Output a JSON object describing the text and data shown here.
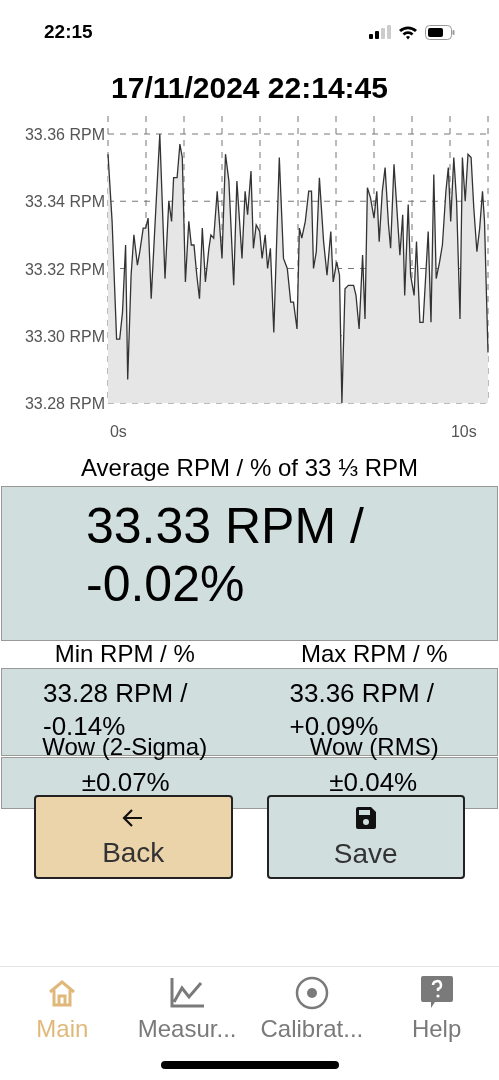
{
  "status_bar": {
    "time": "22:15"
  },
  "title": "17/11/2024 22:14:45",
  "chart": {
    "chart_data": {
      "type": "area",
      "grid": true,
      "xlim": [
        -0.3,
        10.7
      ],
      "ylim": [
        33.28,
        33.36
      ],
      "xticks": [
        {
          "value": 0,
          "label": "0s"
        },
        {
          "value": 10,
          "label": "10s"
        }
      ],
      "yticks": [
        {
          "value": 33.28,
          "label": "33.28 RPM"
        },
        {
          "value": 33.3,
          "label": "33.30 RPM"
        },
        {
          "value": 33.32,
          "label": "33.32 RPM"
        },
        {
          "value": 33.34,
          "label": "33.34 RPM"
        },
        {
          "value": 33.36,
          "label": "33.36 RPM"
        }
      ],
      "x": [
        -0.3,
        -0.18,
        -0.05,
        0.04,
        0.12,
        0.21,
        0.27,
        0.37,
        0.45,
        0.55,
        0.62,
        0.72,
        0.79,
        0.86,
        0.95,
        1.08,
        1.2,
        1.35,
        1.46,
        1.54,
        1.6,
        1.7,
        1.78,
        1.85,
        1.94,
        2.04,
        2.11,
        2.19,
        2.27,
        2.35,
        2.43,
        2.52,
        2.62,
        2.68,
        2.76,
        2.86,
        3,
        3.1,
        3.2,
        3.34,
        3.43,
        3.58,
        3.67,
        3.74,
        3.84,
        3.91,
        3.99,
        4.09,
        4.16,
        4.25,
        4.32,
        4.4,
        4.5,
        4.66,
        4.78,
        4.89,
        4.99,
        5.07,
        5.17,
        5.24,
        5.31,
        5.41,
        5.51,
        5.59,
        5.65,
        5.73,
        5.82,
        5.94,
        6.04,
        6.15,
        6.22,
        6.32,
        6.4,
        6.47,
        6.56,
        6.66,
        6.81,
        6.88,
        6.97,
        7.07,
        7.14,
        7.21,
        7.3,
        7.4,
        7.48,
        7.55,
        7.64,
        7.72,
        7.82,
        7.88,
        7.98,
        8.15,
        8.23,
        8.29,
        8.39,
        8.46,
        8.56,
        8.63,
        8.73,
        8.82,
        8.97,
        9.05,
        9.13,
        9.2,
        9.3,
        9.38,
        9.48,
        9.55,
        9.62,
        9.71,
        9.79,
        9.89,
        9.96,
        10.04,
        10.12,
        10.21,
        10.29,
        10.38,
        10.46,
        10.54,
        10.6,
        10.7
      ],
      "series": [
        {
          "color": "#e6e6e6",
          "values": [
            33.354,
            33.334,
            33.299,
            33.299,
            33.307,
            33.327,
            33.287,
            33.318,
            33.33,
            33.321,
            33.325,
            33.332,
            33.332,
            33.335,
            33.311,
            33.337,
            33.36,
            33.317,
            33.34,
            33.334,
            33.347,
            33.347,
            33.357,
            33.353,
            33.316,
            33.334,
            33.327,
            33.327,
            33.318,
            33.311,
            33.332,
            33.316,
            33.326,
            33.33,
            33.329,
            33.343,
            33.323,
            33.354,
            33.346,
            33.315,
            33.346,
            33.323,
            33.343,
            33.336,
            33.349,
            33.326,
            33.333,
            33.331,
            33.323,
            33.33,
            33.32,
            33.326,
            33.301,
            33.353,
            33.323,
            33.32,
            33.31,
            33.31,
            33.302,
            33.332,
            33.329,
            33.334,
            33.343,
            33.343,
            33.32,
            33.325,
            33.347,
            33.328,
            33.318,
            33.331,
            33.316,
            33.322,
            33.318,
            33.28,
            33.314,
            33.315,
            33.315,
            33.312,
            33.302,
            33.324,
            33.305,
            33.344,
            33.341,
            33.335,
            33.343,
            33.328,
            33.343,
            33.35,
            33.333,
            33.326,
            33.351,
            33.324,
            33.336,
            33.312,
            33.339,
            33.318,
            33.312,
            33.328,
            33.304,
            33.304,
            33.331,
            33.304,
            33.348,
            33.317,
            33.322,
            33.327,
            33.343,
            33.35,
            33.334,
            33.353,
            33.34,
            33.305,
            33.353,
            33.34,
            33.354,
            33.353,
            33.338,
            33.325,
            33.332,
            33.343,
            33.334,
            33.295
          ]
        }
      ]
    }
  },
  "average": {
    "label": "Average RPM / % of 33 ⅓ RPM",
    "value": "33.33 RPM / -0.02%"
  },
  "min_max": [
    {
      "label": "Min RPM / %",
      "value": "33.28 RPM / -0.14%"
    },
    {
      "label": "Max RPM / %",
      "value": "33.36 RPM / +0.09%"
    }
  ],
  "wow": [
    {
      "label": "Wow (2-Sigma)",
      "value": "±0.07%"
    },
    {
      "label": "Wow (RMS)",
      "value": "±0.04%"
    }
  ],
  "buttons": [
    {
      "kind": "back",
      "label": "Back"
    },
    {
      "kind": "save",
      "label": "Save"
    }
  ],
  "tabs": [
    {
      "kind": "home",
      "label": "Main",
      "selected": true
    },
    {
      "kind": "chart",
      "label": "Measur...",
      "selected": false
    },
    {
      "kind": "target",
      "label": "Calibrat...",
      "selected": false
    },
    {
      "kind": "help",
      "label": "Help",
      "selected": false
    }
  ]
}
